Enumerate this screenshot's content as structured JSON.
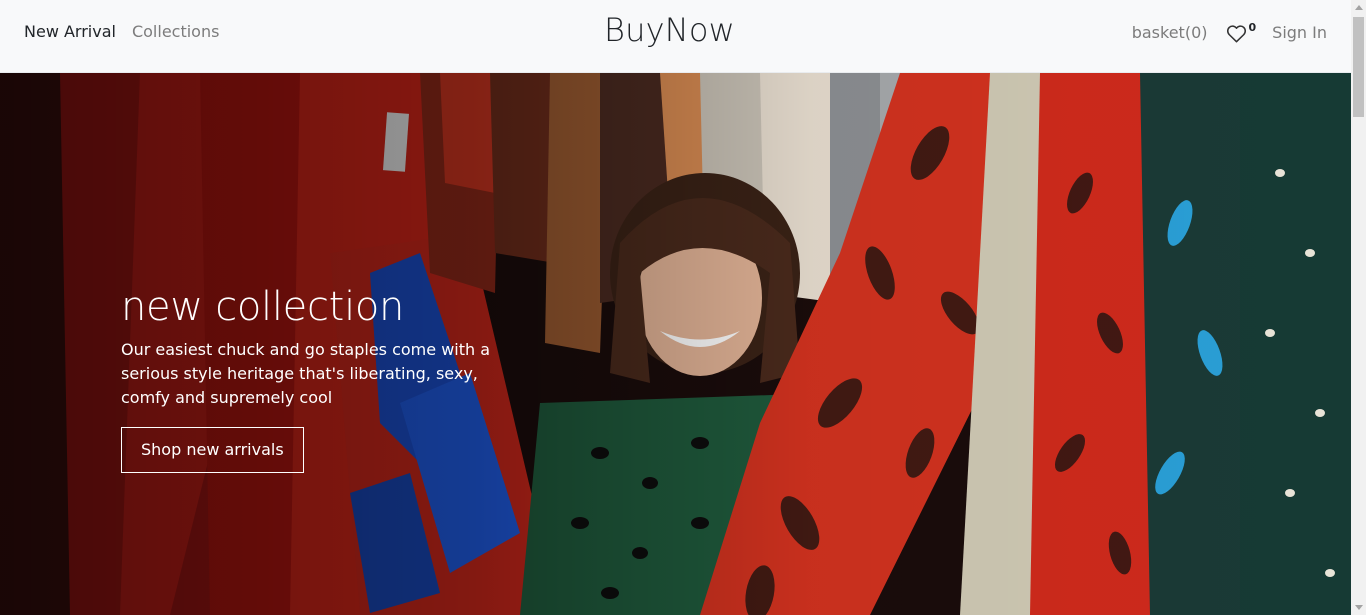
{
  "header": {
    "nav_left": [
      "New Arrival",
      "Collections"
    ],
    "brand": "BuyNow",
    "basket_label": "basket(0)",
    "wishlist_count": "0",
    "signin_label": "Sign In"
  },
  "hero": {
    "title": "new collection",
    "description": "Our easiest chuck and go staples come with a serious style heritage that's liberating, sexy, comfy and supremely cool",
    "button_label": "Shop new arrivals"
  },
  "icons": {
    "wishlist": "heart-icon"
  }
}
